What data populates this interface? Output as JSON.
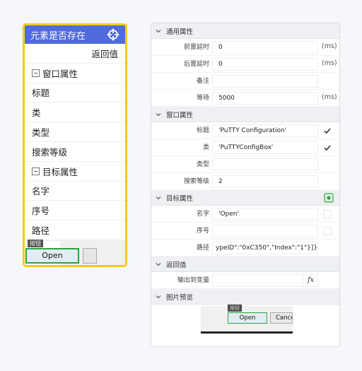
{
  "card": {
    "title": "元素是否存在",
    "return_label": "返回值",
    "window_section": "窗口属性",
    "window_items": [
      "标题",
      "类",
      "类型",
      "搜索等级"
    ],
    "target_section": "目标属性",
    "target_items": [
      "名字",
      "序号",
      "路径"
    ],
    "preview": {
      "tooltip": "按钮",
      "open_label": "Open"
    }
  },
  "panel": {
    "general": {
      "title": "通用属性",
      "rows": [
        {
          "label": "前置延时",
          "value": "0",
          "unit": "(ms)"
        },
        {
          "label": "后置延时",
          "value": "0",
          "unit": "(ms)"
        },
        {
          "label": "备注",
          "value": ""
        },
        {
          "label": "等待",
          "value": "5000",
          "unit": "(ms)"
        }
      ]
    },
    "window": {
      "title": "窗口属性",
      "rows": [
        {
          "label": "标题",
          "value": "'PuTTY Configuration'",
          "checked": true
        },
        {
          "label": "类",
          "value": "'PuTTYConfigBox'",
          "checked": true
        },
        {
          "label": "类型",
          "value": ""
        },
        {
          "label": "搜索等级",
          "value": "2"
        }
      ]
    },
    "target": {
      "title": "目标属性",
      "rows": [
        {
          "label": "名字",
          "value": "'Open'",
          "checked": false
        },
        {
          "label": "序号",
          "value": "",
          "checked": false
        },
        {
          "label": "路径",
          "value": "ypeID\":\"0xC350\",\"Index\":\"1\"}]}"
        }
      ]
    },
    "return": {
      "title": "返回值",
      "rows": [
        {
          "label": "输出到变量",
          "value": ""
        }
      ]
    },
    "preview": {
      "title": "图片预览",
      "tooltip": "按钮",
      "open_label": "Open",
      "cancel_label": "Cancel"
    }
  },
  "colors": {
    "header_blue": "#4f6bdc",
    "highlight_yellow": "#f2cc1c",
    "focus_green": "#2ca43c"
  }
}
